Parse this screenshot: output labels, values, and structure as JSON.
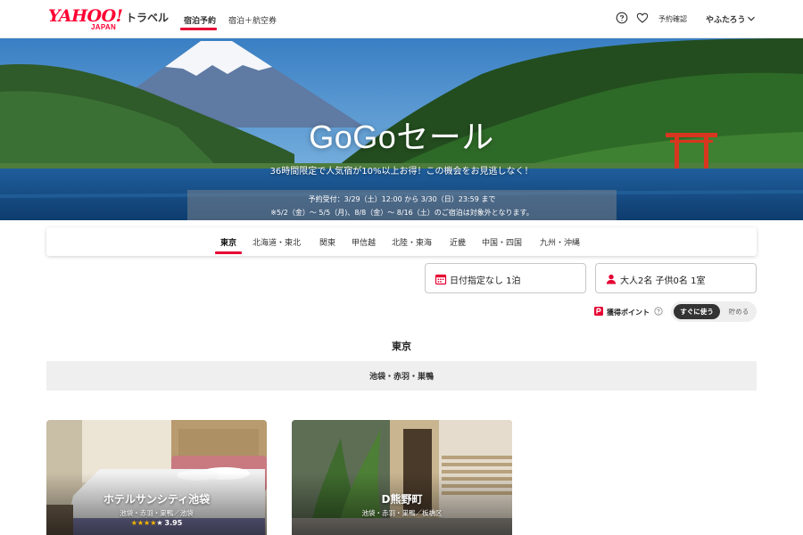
{
  "header": {
    "logo_main": "YAHOO!",
    "logo_sub": "JAPAN",
    "logo_service": "トラベル",
    "tabs": [
      {
        "label": "宿泊予約",
        "active": true
      },
      {
        "label": "宿泊＋航空券",
        "active": false
      }
    ],
    "help_icon": "question-circle-icon",
    "favorite_icon": "heart-icon",
    "reservation_label": "予約確認",
    "user_label": "やふたろう",
    "accent_color": "#e60033"
  },
  "hero": {
    "title": "GoGoセール",
    "subtitle": "36時間限定で人気宿が10%以上お得！この機会をお見逃しなく！",
    "period_line": "予約受付：3/29（土）12:00 から 3/30（日）23:59 まで",
    "exclusion_line": "※5/2（金）〜 5/5（月)、8/8（金）〜 8/16（土）のご宿泊は対象外となります。"
  },
  "regions": {
    "tabs": [
      "東京",
      "北海道・東北",
      "関東",
      "甲信越",
      "北陸・東海",
      "近畿",
      "中国・四国",
      "九州・沖縄"
    ],
    "active_index": 0
  },
  "search": {
    "date_icon": "calendar-icon",
    "date_label": "日付指定なし 1泊",
    "guest_icon": "person-icon",
    "guest_label": "大人2名 子供0名 1室"
  },
  "points": {
    "icon": "point-badge-icon",
    "label": "獲得ポイント",
    "help_icon": "question-circle-icon",
    "toggle_on": "すぐに使う",
    "toggle_off": "貯める"
  },
  "section": {
    "title": "東京",
    "area": "池袋・赤羽・巣鴨"
  },
  "hotels": [
    {
      "name": "ホテルサンシティ池袋",
      "location": "池袋・赤羽・巣鴨／池袋",
      "stars_filled": 4,
      "stars_total": 5,
      "rating": "3.95"
    },
    {
      "name": "D熊野町",
      "location": "池袋・赤羽・巣鴨／板橋区"
    }
  ]
}
